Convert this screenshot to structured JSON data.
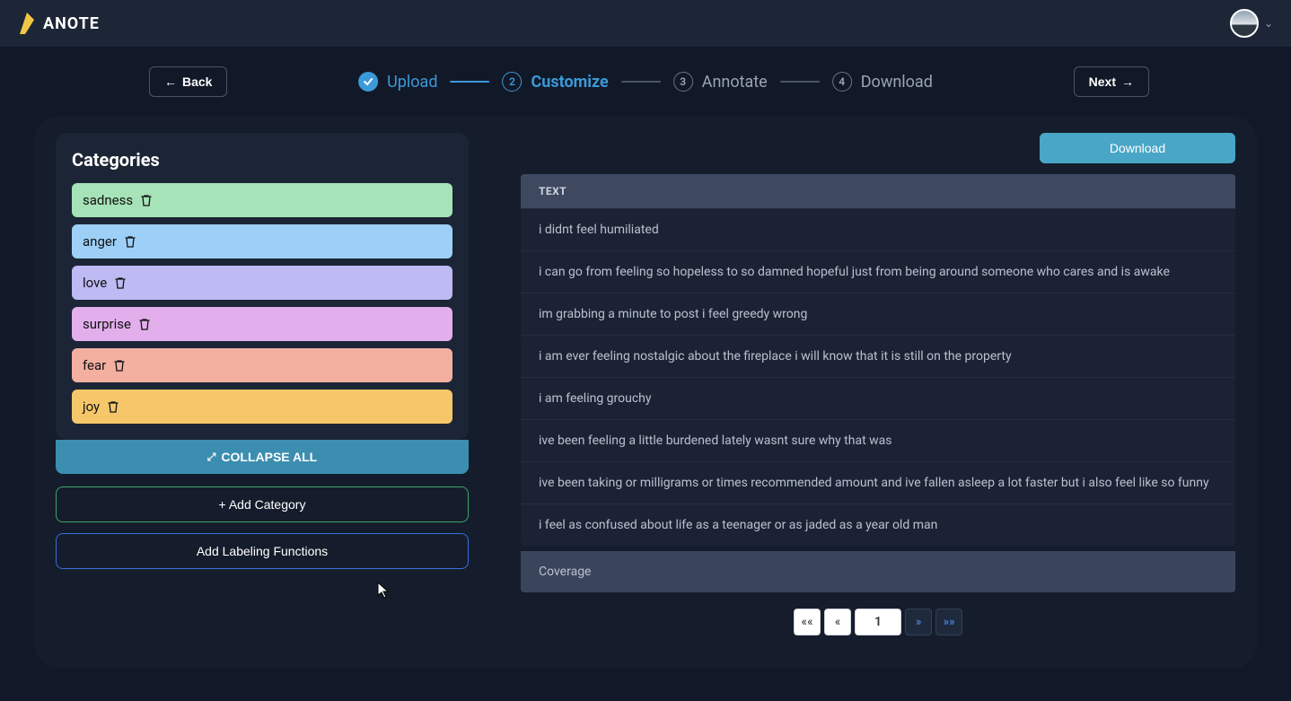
{
  "brand": "ANOTE",
  "header": {
    "back_label": "Back",
    "next_label": "Next"
  },
  "steps": [
    {
      "num": "✓",
      "label": "Upload",
      "state": "done"
    },
    {
      "num": "2",
      "label": "Customize",
      "state": "current"
    },
    {
      "num": "3",
      "label": "Annotate",
      "state": "pending"
    },
    {
      "num": "4",
      "label": "Download",
      "state": "pending"
    }
  ],
  "sidebar": {
    "title": "Categories",
    "collapse_label": "COLLAPSE ALL",
    "add_category_label": "+ Add Category",
    "add_labeling_label": "Add Labeling Functions",
    "categories": [
      {
        "name": "sadness",
        "color": "#a6e3b8"
      },
      {
        "name": "anger",
        "color": "#9ed0f7"
      },
      {
        "name": "love",
        "color": "#bdbaf4"
      },
      {
        "name": "surprise",
        "color": "#e2afec"
      },
      {
        "name": "fear",
        "color": "#f3b0a1"
      },
      {
        "name": "joy",
        "color": "#f6c76a"
      }
    ]
  },
  "table": {
    "download_label": "Download",
    "header": "TEXT",
    "rows": [
      "i didnt feel humiliated",
      "i can go from feeling so hopeless to so damned hopeful just from being around someone who cares and is awake",
      "im grabbing a minute to post i feel greedy wrong",
      "i am ever feeling nostalgic about the fireplace i will know that it is still on the property",
      "i am feeling grouchy",
      "ive been feeling a little burdened lately wasnt sure why that was",
      "ive been taking or milligrams or times recommended amount and ive fallen asleep a lot faster but i also feel like so funny",
      "i feel as confused about life as a teenager or as jaded as a year old man"
    ],
    "coverage_label": "Coverage"
  },
  "pagination": {
    "first": "««",
    "prev": "«",
    "page": "1",
    "next": "»",
    "last": "»»"
  }
}
